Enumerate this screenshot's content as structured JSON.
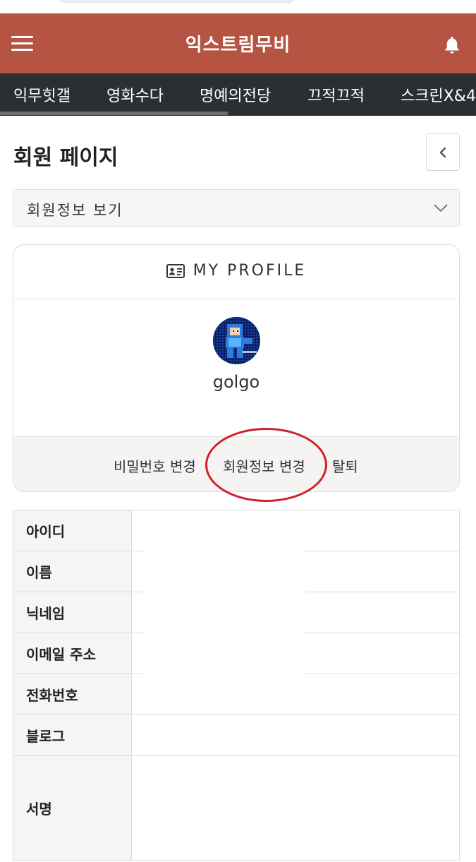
{
  "header": {
    "site_title": "익스트림무비",
    "menu_icon": "hamburger-icon",
    "notification_icon": "bell-icon",
    "brand_color": "#b55443"
  },
  "nav": {
    "tabs": [
      {
        "label": "익무힛갤"
      },
      {
        "label": "영화수다"
      },
      {
        "label": "명예의전당"
      },
      {
        "label": "끄적끄적"
      },
      {
        "label": "스크린X&4"
      }
    ],
    "bg_color": "#2b2f33"
  },
  "page": {
    "title": "회원 페이지",
    "back_icon": "chevron-left-icon"
  },
  "view_select": {
    "selected": "회원정보 보기",
    "icon": "chevron-down-icon"
  },
  "profile": {
    "header_label": "MY PROFILE",
    "header_icon": "id-card-icon",
    "username": "golgo",
    "actions": {
      "change_password": "비밀번호 변경",
      "edit_info": "회원정보 변경",
      "withdraw": "탈퇴"
    }
  },
  "info_table": {
    "rows": [
      {
        "label": "아이디",
        "value": ""
      },
      {
        "label": "이름",
        "value": ""
      },
      {
        "label": "닉네임",
        "value": ""
      },
      {
        "label": "이메일 주소",
        "value": ""
      },
      {
        "label": "전화번호",
        "value": ""
      },
      {
        "label": "블로그",
        "value": ""
      },
      {
        "label": "서명",
        "value": ""
      }
    ]
  },
  "annotation": {
    "highlight_color": "#d21f2a"
  }
}
